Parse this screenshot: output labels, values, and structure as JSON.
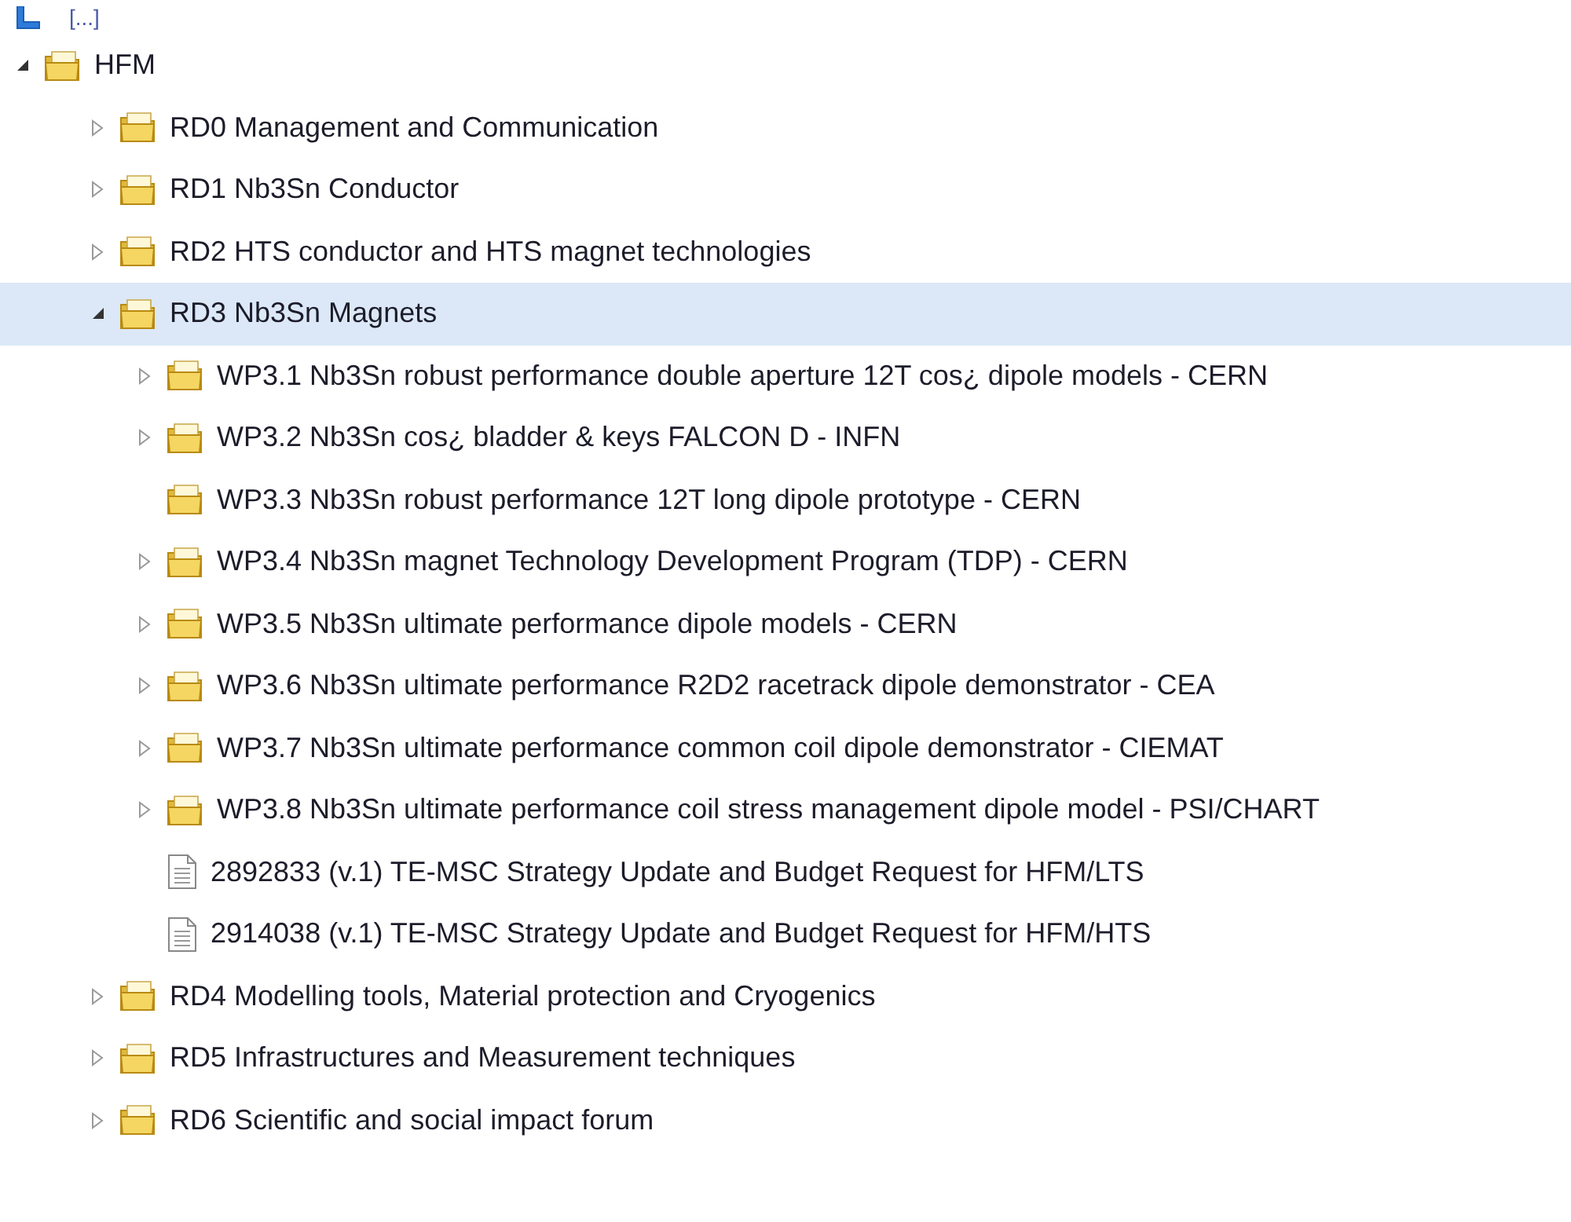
{
  "tree": {
    "root": {
      "label": "[...]"
    },
    "nodes": [
      {
        "label": "HFM",
        "kind": "folder",
        "expandable": true,
        "expanded": true,
        "selected": false,
        "children": [
          {
            "label": "RD0 Management and Communication",
            "kind": "folder",
            "expandable": true,
            "expanded": false,
            "selected": false
          },
          {
            "label": "RD1 Nb3Sn Conductor",
            "kind": "folder",
            "expandable": true,
            "expanded": false,
            "selected": false
          },
          {
            "label": "RD2 HTS conductor and HTS magnet technologies",
            "kind": "folder",
            "expandable": true,
            "expanded": false,
            "selected": false
          },
          {
            "label": "RD3 Nb3Sn Magnets",
            "kind": "folder",
            "expandable": true,
            "expanded": true,
            "selected": true,
            "children": [
              {
                "label": "WP3.1 Nb3Sn robust performance double aperture 12T cos¿ dipole models - CERN",
                "kind": "folder",
                "expandable": true,
                "expanded": false,
                "selected": false
              },
              {
                "label": "WP3.2 Nb3Sn cos¿ bladder & keys FALCON D - INFN",
                "kind": "folder",
                "expandable": true,
                "expanded": false,
                "selected": false
              },
              {
                "label": "WP3.3 Nb3Sn robust performance 12T long dipole prototype - CERN",
                "kind": "folder",
                "expandable": false,
                "selected": false
              },
              {
                "label": "WP3.4 Nb3Sn magnet Technology Development Program (TDP) - CERN",
                "kind": "folder",
                "expandable": true,
                "expanded": false,
                "selected": false
              },
              {
                "label": "WP3.5 Nb3Sn ultimate performance dipole models - CERN",
                "kind": "folder",
                "expandable": true,
                "expanded": false,
                "selected": false
              },
              {
                "label": "WP3.6 Nb3Sn ultimate performance R2D2 racetrack dipole demonstrator - CEA",
                "kind": "folder",
                "expandable": true,
                "expanded": false,
                "selected": false
              },
              {
                "label": "WP3.7 Nb3Sn ultimate performance common coil dipole demonstrator - CIEMAT",
                "kind": "folder",
                "expandable": true,
                "expanded": false,
                "selected": false
              },
              {
                "label": "WP3.8 Nb3Sn ultimate performance coil stress management dipole model - PSI/CHART",
                "kind": "folder",
                "expandable": true,
                "expanded": false,
                "selected": false
              },
              {
                "label": "2892833 (v.1) TE-MSC Strategy Update and Budget Request for HFM/LTS",
                "kind": "document",
                "expandable": false,
                "selected": false
              },
              {
                "label": "2914038 (v.1) TE-MSC Strategy Update and Budget Request for HFM/HTS",
                "kind": "document",
                "expandable": false,
                "selected": false
              }
            ]
          },
          {
            "label": "RD4 Modelling tools, Material protection and Cryogenics",
            "kind": "folder",
            "expandable": true,
            "expanded": false,
            "selected": false
          },
          {
            "label": "RD5 Infrastructures and Measurement techniques",
            "kind": "folder",
            "expandable": true,
            "expanded": false,
            "selected": false
          },
          {
            "label": "RD6 Scientific and social impact forum",
            "kind": "folder",
            "expandable": true,
            "expanded": false,
            "selected": false
          }
        ]
      }
    ]
  }
}
